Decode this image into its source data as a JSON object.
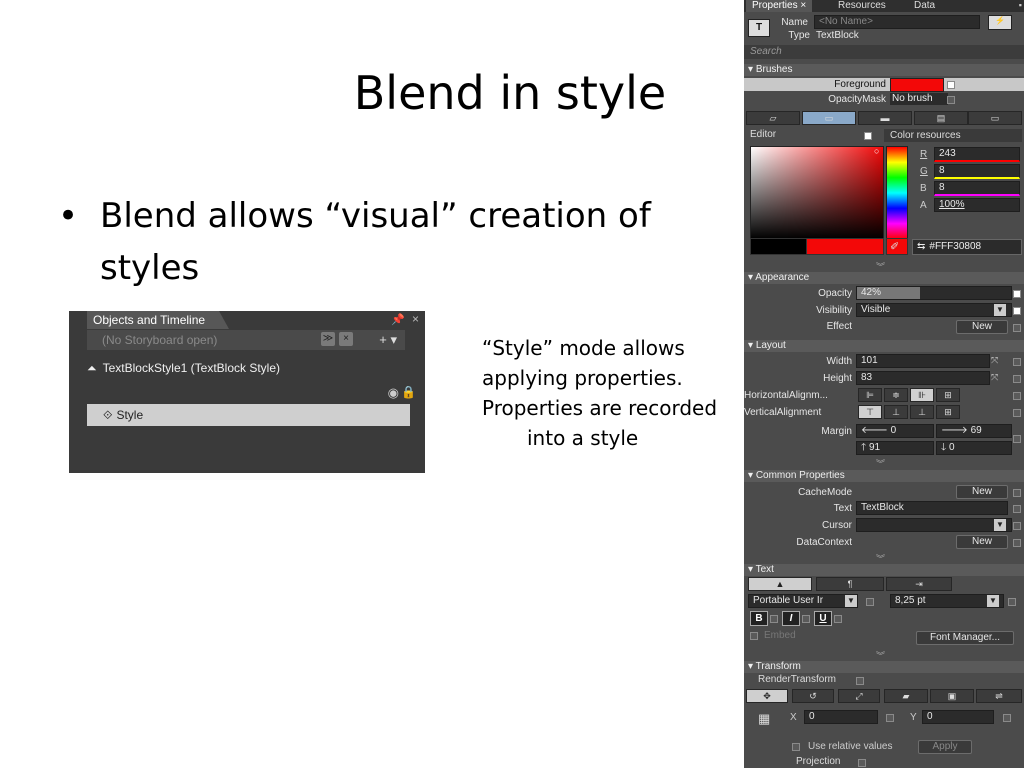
{
  "slide": {
    "title": "Blend in style",
    "bullet_text": "Blend allows “visual” creation of styles",
    "note_lines": [
      "“Style” mode allows",
      "applying properties.",
      "Properties are recorded",
      "into a style"
    ]
  },
  "objects_timeline": {
    "tab_label": "Objects and Timeline",
    "storyboard": "(No Storyboard open)",
    "style_item": "TextBlockStyle1 (TextBlock Style)",
    "selected_item": "Style"
  },
  "properties": {
    "tabs": [
      "Properties",
      "Resources",
      "Data"
    ],
    "name_label": "Name",
    "name_placeholder": "<No Name>",
    "type_label": "Type",
    "type_value": "TextBlock",
    "search_placeholder": "Search",
    "brushes": {
      "header": "Brushes",
      "foreground_label": "Foreground",
      "foreground_color": "#F30808",
      "opacitymask_label": "OpacityMask",
      "opacitymask_value": "No brush"
    },
    "editor": {
      "label": "Editor",
      "color_resources": "Color resources",
      "channels": [
        {
          "name": "R",
          "value": "243"
        },
        {
          "name": "G",
          "value": "8"
        },
        {
          "name": "B",
          "value": "8"
        },
        {
          "name": "A",
          "value": "100%"
        }
      ],
      "hex": "#FFF30808"
    },
    "appearance": {
      "header": "Appearance",
      "opacity_label": "Opacity",
      "opacity_value": "42%",
      "visibility_label": "Visibility",
      "visibility_value": "Visible",
      "effect_label": "Effect",
      "new_label": "New"
    },
    "layout": {
      "header": "Layout",
      "width_label": "Width",
      "width_value": "101",
      "height_label": "Height",
      "height_value": "83",
      "halign_label": "HorizontalAlignm...",
      "valign_label": "VerticalAlignment",
      "margin_label": "Margin",
      "margin": {
        "left": "0",
        "right": "69",
        "top": "91",
        "bottom": "0"
      }
    },
    "common": {
      "header": "Common Properties",
      "cachemode_label": "CacheMode",
      "text_label": "Text",
      "text_value": "TextBlock",
      "cursor_label": "Cursor",
      "datacontext_label": "DataContext",
      "new_label": "New"
    },
    "text": {
      "header": "Text",
      "font_family": "Portable User Ir",
      "font_size": "8,25 pt",
      "bold": "B",
      "italic": "I",
      "underline": "U",
      "embed": "Embed",
      "font_manager": "Font Manager..."
    },
    "transform": {
      "header": "Transform",
      "render_label": "RenderTransform",
      "x_label": "X",
      "x_value": "0",
      "y_label": "Y",
      "y_value": "0",
      "relative_label": "Use relative values",
      "apply_label": "Apply",
      "projection_label": "Projection"
    }
  }
}
